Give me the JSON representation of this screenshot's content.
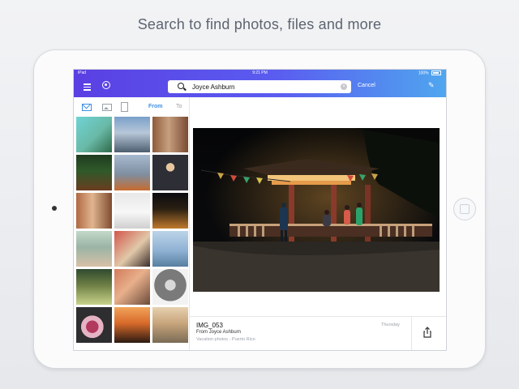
{
  "headline": "Search to find photos, files and more",
  "status": {
    "carrier": "iPad",
    "time": "9:21 PM",
    "battery": "100%"
  },
  "search": {
    "value": "Joyce Ashburn",
    "cancel_label": "Cancel"
  },
  "filters": {
    "from_label": "From",
    "to_label": "To"
  },
  "detail": {
    "file_name": "IMG_053",
    "sender": "From Joyce Ashburn",
    "subject": "Vacation photos - Puerto Rico",
    "date": "Thursday"
  },
  "colors": {
    "accent": "#3f8fe6",
    "topbar_start": "#5a3fe3",
    "topbar_end": "#4fa6ef"
  },
  "icons": [
    "menu-icon",
    "account-icon",
    "search-icon",
    "clear-icon",
    "compose-icon",
    "mail-icon",
    "photo-icon",
    "doc-icon",
    "share-icon"
  ]
}
